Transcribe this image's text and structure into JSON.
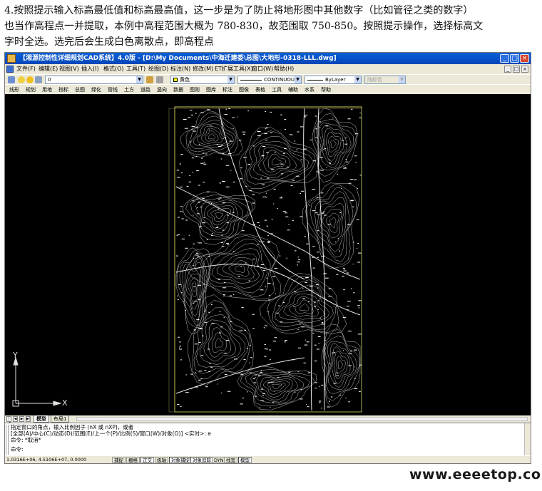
{
  "caption": {
    "line1": "4.按照提示输入标高最低值和标高最高值，这一步是为了防止将地形图中其他数字（比如管径之类的数字）",
    "line2": "也当作高程点一并提取，本例中高程范围大概为 780-830，故范围取 750-850。按照提示操作，选择标高文",
    "line3": "字时全选。选完后会生成白色离散点，即高程点"
  },
  "window": {
    "title": "【湘源控制性详细规划CAD系统】4.0版 - [D:\\My Documents\\中海迁建委\\总图\\大地形-0318-LLL.dwg]",
    "minimize": "_",
    "maximize": "□",
    "close": "×"
  },
  "menu": {
    "items": [
      "文件(F)",
      "编辑(E)",
      "视图(V)",
      "插入(I)",
      "格式(O)",
      "工具(T)",
      "绘图(D)",
      "标注(N)",
      "修改(M)",
      "ET扩展工具(X)",
      "窗口(W)",
      "帮助(H)"
    ]
  },
  "toolbar": {
    "layer_value": "0",
    "color_value": "黄色",
    "linetype_value": "CONTINUOUS",
    "lineweight_value": "ByLayer",
    "plotstyle_value": "随颜色"
  },
  "toolbar2": {
    "items": [
      "线形",
      "规划",
      "用地",
      "指标",
      "总图",
      "绿化",
      "管线",
      "土方",
      "道路",
      "竖向",
      "数据",
      "图则",
      "图库",
      "标注",
      "图像",
      "表格",
      "工具",
      "辅助",
      "水系",
      "帮助"
    ]
  },
  "canvas": {
    "ucs_x": "X",
    "ucs_y": "Y"
  },
  "layout_tabs": {
    "nav": [
      "|◀",
      "◀",
      "▶",
      "▶|"
    ],
    "tabs": [
      "模型",
      "布局1"
    ]
  },
  "command": {
    "line1": "指定窗口的角点，输入比例因子 (nX 或 nXP)，或者",
    "line2": "[全部(A)/中心(C)/动态(D)/范围(E)/上一个(P)/比例(S)/窗口(W)/对象(O)] <实时>: e",
    "line3": "命令: *取消*",
    "line4": "命令:"
  },
  "status": {
    "coords": "1.0316E+06, 4.5106E+07, 0.0000",
    "buttons": [
      "捕捉",
      "栅格",
      "正交",
      "极轴",
      "对象捕捉",
      "对象追踪",
      "DYN",
      "线宽",
      "模型"
    ]
  },
  "watermark": "www.eeeetop.com",
  "colors": {
    "title_bar": "#0a5fd8",
    "canvas": "#000000",
    "frame": "#c8c850",
    "contour": "#bdbdbd"
  }
}
